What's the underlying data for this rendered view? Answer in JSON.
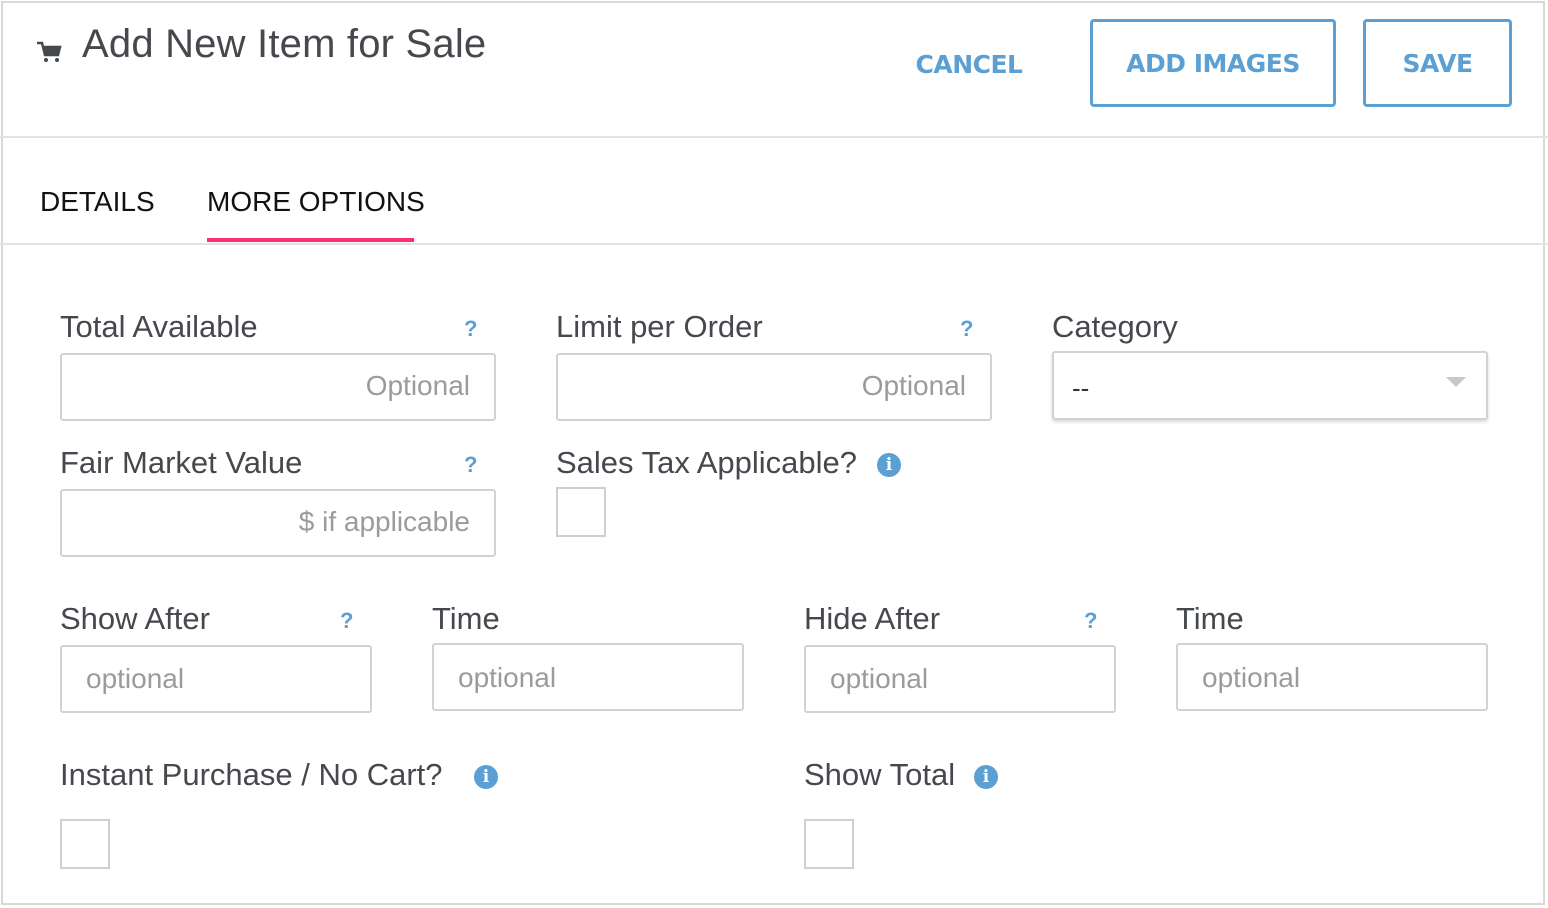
{
  "header": {
    "icon": "shopping-cart-icon",
    "title": "Add New Item for Sale",
    "cancel_label": "CANCEL",
    "add_images_label": "ADD IMAGES",
    "save_label": "SAVE"
  },
  "tabs": [
    {
      "label": "DETAILS",
      "active": false
    },
    {
      "label": "MORE OPTIONS",
      "active": true
    }
  ],
  "colors": {
    "accent": "#5ca0d3",
    "tab_underline": "#ff2d78",
    "text": "#45484d"
  },
  "form": {
    "total_available": {
      "label": "Total Available",
      "help": "?",
      "value": "",
      "placeholder": "Optional"
    },
    "limit_per_order": {
      "label": "Limit per Order",
      "help": "?",
      "value": "",
      "placeholder": "Optional"
    },
    "category": {
      "label": "Category",
      "selected": "--"
    },
    "fair_market_value": {
      "label": "Fair Market Value",
      "help": "?",
      "value": "",
      "placeholder": "$ if applicable"
    },
    "sales_tax": {
      "label": "Sales Tax Applicable?",
      "info": "i",
      "checked": false
    },
    "show_after": {
      "label": "Show After",
      "help": "?",
      "value": "",
      "placeholder": "optional"
    },
    "show_after_time": {
      "label": "Time",
      "value": "",
      "placeholder": "optional"
    },
    "hide_after": {
      "label": "Hide After",
      "help": "?",
      "value": "",
      "placeholder": "optional"
    },
    "hide_after_time": {
      "label": "Time",
      "value": "",
      "placeholder": "optional"
    },
    "instant_purchase": {
      "label": "Instant Purchase / No Cart?",
      "info": "i",
      "checked": false
    },
    "show_total": {
      "label": "Show Total",
      "info": "i",
      "checked": false
    }
  }
}
